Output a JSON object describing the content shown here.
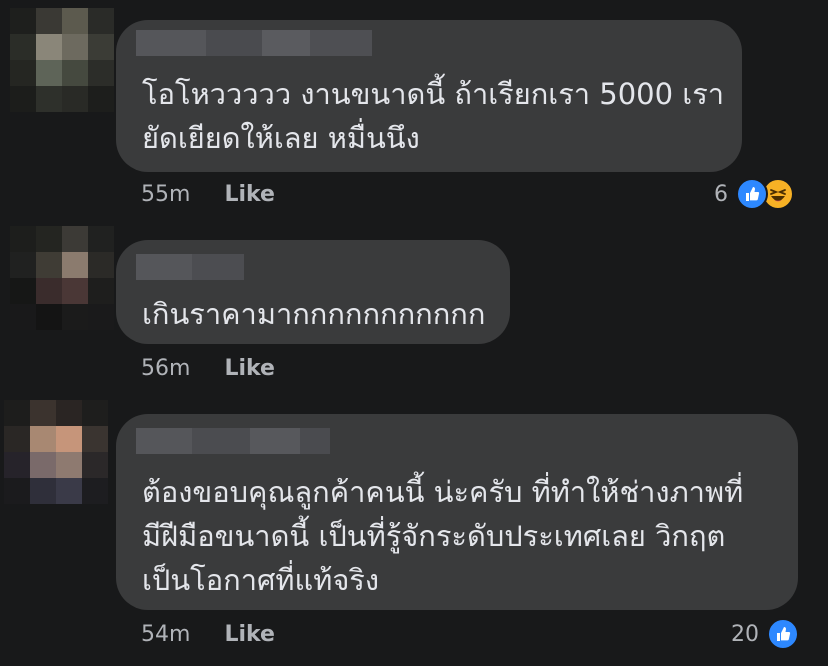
{
  "comments": [
    {
      "text": "โอโหววววว งานขนาดนี้ ถ้าเรียกเรา 5000 เรา\nยัดเยียดให้เลย หมื่นนึง",
      "time": "55m",
      "like_label": "Like",
      "reaction_count": "6",
      "reactions": [
        "like-icon",
        "haha-icon"
      ]
    },
    {
      "text": "เกินราคามากกกกกกกกกกก",
      "time": "56m",
      "like_label": "Like",
      "reaction_count": "",
      "reactions": []
    },
    {
      "text": "ต้องขอบคุณลูกค้าคนนี้ น่ะครับ  ที่ทำให้ช่างภาพที่\nมีฝีมือขนาดนี้ เป็นที่รู้จักระดับประเทศเลย  วิกฤต\nเป็นโอกาศที่แท้จริง",
      "time": "54m",
      "like_label": "Like",
      "reaction_count": "20",
      "reactions": [
        "like-icon"
      ]
    }
  ],
  "colors": {
    "background": "#18191a",
    "bubble": "#3a3b3c",
    "text": "#e4e6eb",
    "meta_text": "#b0b3b8",
    "like_reaction": "#2d88ff",
    "haha_reaction": "#f7b125"
  }
}
